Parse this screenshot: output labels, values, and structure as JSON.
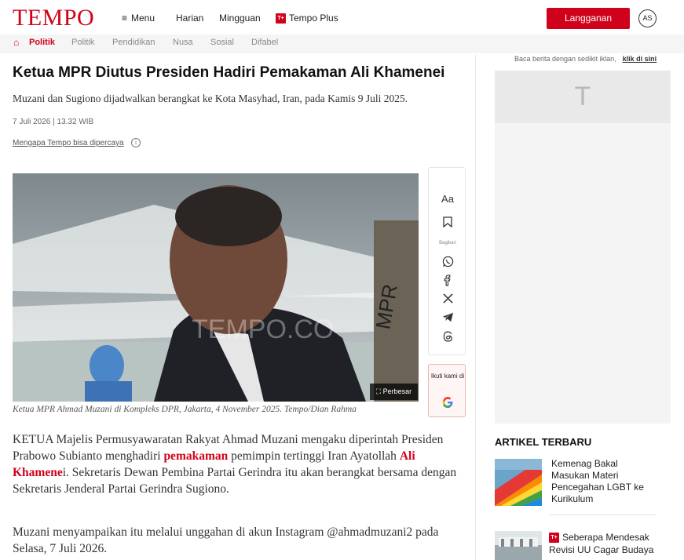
{
  "header": {
    "logo": "TEMPO",
    "menu_label": "Menu",
    "nav": [
      "Harian",
      "Mingguan",
      "Tempo Plus"
    ],
    "tempo_plus_badge": "T+",
    "subscribe_label": "Langganan",
    "avatar_initials": "AS",
    "brand_color": "#d0021b"
  },
  "subnav": {
    "active": "Politik",
    "items": [
      "Politik",
      "Pendidikan",
      "Nusa",
      "Sosial",
      "Difabel"
    ]
  },
  "article": {
    "title": "Ketua MPR Diutus Presiden Hadiri Pemakaman Ali Khamenei",
    "lead": "Muzani dan Sugiono dijadwalkan berangkat ke Kota Masyhad, Iran, pada Kamis 9 Juli 2025.",
    "date": "7 Juli 2026 | 13.32 WIB",
    "trust_link": "Mengapa Tempo bisa dipercaya",
    "photo_watermark": "TEMPO.CO",
    "enlarge_label": "Perbesar",
    "caption": "Ketua MPR Ahmad Muzani di Kompleks DPR, Jakarta, 4 November 2025. Tempo/Dian Rahma",
    "p1_a": "KETUA Majelis Permusyawaratan Rakyat Ahmad Muzani mengaku diperintah Presiden Prabowo Subianto menghadiri ",
    "p1_link1": "pemakaman",
    "p1_b": " pemimpin tertinggi Iran Ayatollah ",
    "p1_link2": "Ali Khamene",
    "p1_c": "i. Sekretaris Dewan Pembina Partai Gerindra itu akan berangkat bersama dengan Sekretaris Jenderal Partai Gerindra Sugiono.",
    "p2": "Muzani menyampaikan itu melalui unggahan di akun Instagram @ahmadmuzani2 pada Selasa, 7 Juli 2026."
  },
  "share": {
    "label": "Bagikan",
    "font_size_icon": "Aa",
    "follow_text": "Ikuti kami di"
  },
  "sidebar": {
    "ad_note": "Baca berita dengan sedikit iklan,",
    "ad_link": "klik di sini",
    "ad_placeholder": "T",
    "section_title": "ARTIKEL TERBARU",
    "articles": [
      {
        "title": "Kemenag Bakal Masukan Materi Pencegahan LGBT ke Kurikulum"
      },
      {
        "badge": "T+",
        "title": "Seberapa Mendesak Revisi UU Cagar Budaya"
      }
    ]
  }
}
